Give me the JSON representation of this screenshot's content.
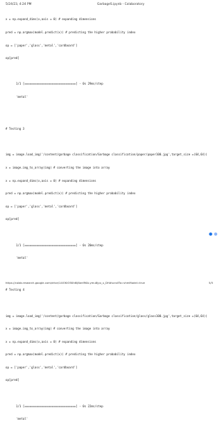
{
  "header": {
    "datetime": "5/24/23, 4:24 PM",
    "page_title": "GarbageS.ipynb - Colaboratory"
  },
  "code_lines": [
    "x = np.expand_dims(x,axis = 0) # expanding dimensions",
    "pred = np.argmax(model.predict(x)) # predicting the higher probability index",
    "op = ['paper','glass','metal','cardboard']",
    "op[pred]"
  ],
  "output_1": {
    "progress": "1/1 [==============================] - 0s 29ms/step",
    "result": "'metal'"
  },
  "testing3": {
    "comment": "# Testing 3",
    "lines": [
      "img = image.load_img('/content/garbage classification/Garbage classification/paper/paper100.jpg',target_size =(64,64))",
      "x = image.img_to_array(img) # converting the image into array",
      "x = np.expand_dims(x,axis = 0) # expanding dimensions",
      "pred = np.argmax(model.predict(x)) # predicting the higher probability index",
      "op = ['paper','glass','metal','cardboard']",
      "op[pred]"
    ],
    "progress": "1/1 [==============================] - 0s 20ms/step",
    "result": "'metal'"
  },
  "testing4": {
    "comment": "# Testing 4",
    "lines": [
      "img = image.load_img('/content/garbage classification/Garbage classification/glass/glass100.jpg',target_size =(64,64))",
      "x = image.img_to_array(img) # converting the image into array",
      "x = np.expand_dims(x,axis = 0) # expanding dimensions",
      "pred = np.argmax(model.predict(x)) # predicting the higher probability index",
      "op = ['paper','glass','metal','cardboard']",
      "op[pred]"
    ],
    "progress": "1/1 [==============================] - 0s 22ms/step",
    "result": "'metal'"
  },
  "footer": {
    "url": "https://colab.research.google.com/drive/14lOKIOSKh6lJ8wrlR6A-ymu8jyo_u_DH#scrollTo=vhmModel=true",
    "page_number": "5/5"
  }
}
